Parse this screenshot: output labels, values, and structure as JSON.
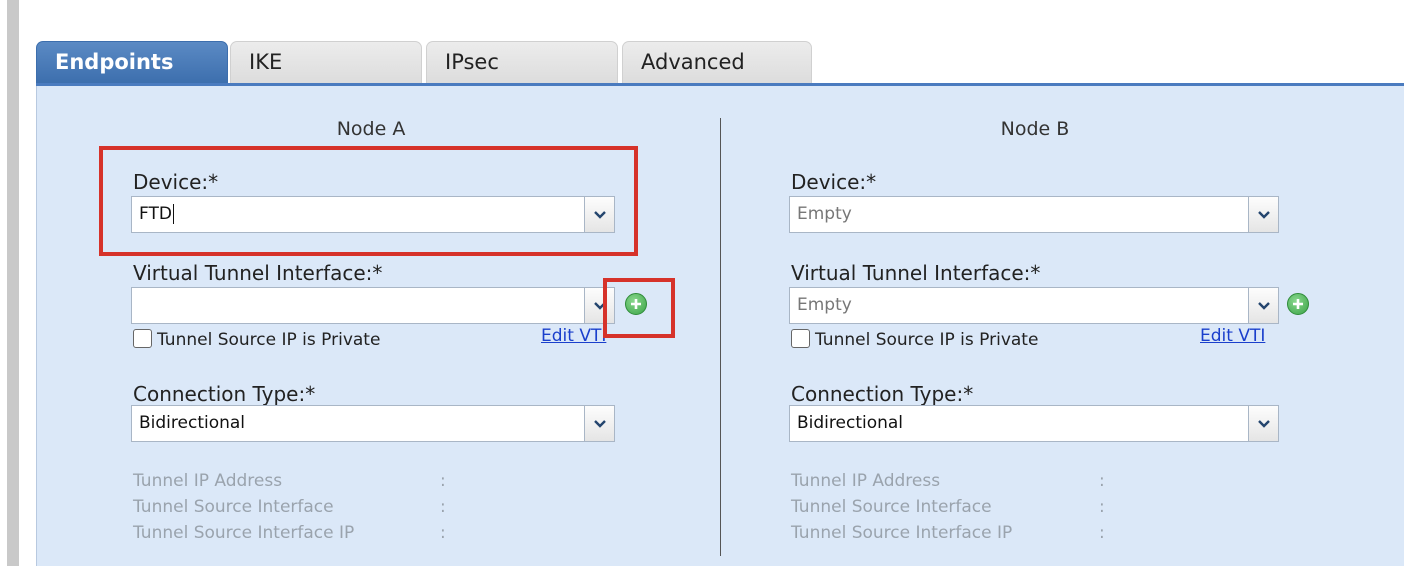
{
  "tabs": [
    {
      "label": "Endpoints",
      "active": true
    },
    {
      "label": "IKE",
      "active": false
    },
    {
      "label": "IPsec",
      "active": false
    },
    {
      "label": "Advanced",
      "active": false
    }
  ],
  "node_a": {
    "title": "Node A",
    "device_label": "Device:*",
    "device_value": "FTD",
    "vti_label": "Virtual Tunnel Interface:*",
    "vti_value": "",
    "tunnel_private_label": "Tunnel Source IP is Private",
    "edit_vti_label": "Edit VTI",
    "connection_type_label": "Connection Type:*",
    "connection_type_value": "Bidirectional",
    "info": [
      {
        "label": "Tunnel IP Address",
        "sep": ":"
      },
      {
        "label": "Tunnel Source Interface",
        "sep": ":"
      },
      {
        "label": "Tunnel Source Interface IP",
        "sep": ":"
      }
    ]
  },
  "node_b": {
    "title": "Node B",
    "device_label": "Device:*",
    "device_value": "Empty",
    "vti_label": "Virtual Tunnel Interface:*",
    "vti_value": "Empty",
    "tunnel_private_label": "Tunnel Source IP is Private",
    "edit_vti_label": "Edit VTI",
    "connection_type_label": "Connection Type:*",
    "connection_type_value": "Bidirectional",
    "info": [
      {
        "label": "Tunnel IP Address",
        "sep": ":"
      },
      {
        "label": "Tunnel Source Interface",
        "sep": ":"
      },
      {
        "label": "Tunnel Source Interface IP",
        "sep": ":"
      }
    ]
  },
  "colors": {
    "tab_active": "#3c6ead",
    "panel_bg": "#dbe8f8",
    "highlight": "#d6322a",
    "link": "#1a3fcc",
    "add_button": "#3aa346"
  },
  "icons": {
    "dropdown": "chevron-down-icon",
    "add": "plus-circle-icon"
  }
}
